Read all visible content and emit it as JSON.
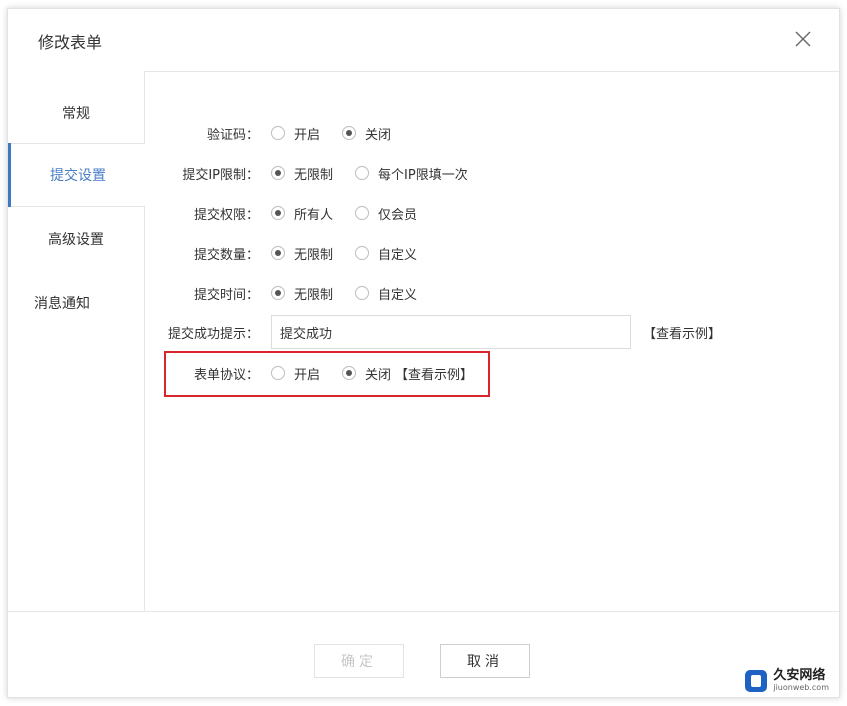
{
  "dialog": {
    "title": "修改表单",
    "close_icon": "close-icon"
  },
  "sidebar": {
    "items": [
      {
        "label": "常规"
      },
      {
        "label": "提交设置"
      },
      {
        "label": "高级设置"
      },
      {
        "label": "消息通知"
      }
    ],
    "active_index": 1,
    "accent_color": "#3f78c5"
  },
  "form": {
    "captcha": {
      "label": "验证码：",
      "options": [
        "开启",
        "关闭"
      ],
      "selected": "关闭"
    },
    "ip_limit": {
      "label": "提交IP限制：",
      "options": [
        "无限制",
        "每个IP限填一次"
      ],
      "selected": "无限制"
    },
    "permission": {
      "label": "提交权限：",
      "options": [
        "所有人",
        "仅会员"
      ],
      "selected": "所有人"
    },
    "count": {
      "label": "提交数量：",
      "options": [
        "无限制",
        "自定义"
      ],
      "selected": "无限制"
    },
    "time": {
      "label": "提交时间：",
      "options": [
        "无限制",
        "自定义"
      ],
      "selected": "无限制"
    },
    "success_tip": {
      "label": "提交成功提示：",
      "value": "提交成功",
      "link": "【查看示例】"
    },
    "agreement": {
      "label": "表单协议：",
      "options": [
        "开启",
        "关闭"
      ],
      "selected": "关闭",
      "link": "【查看示例】"
    }
  },
  "highlight_color": "#d9262c",
  "footer": {
    "ok_label": "确定",
    "cancel_label": "取消"
  },
  "watermark": {
    "cn": "久安网络",
    "en": "jiuonweb.com"
  }
}
